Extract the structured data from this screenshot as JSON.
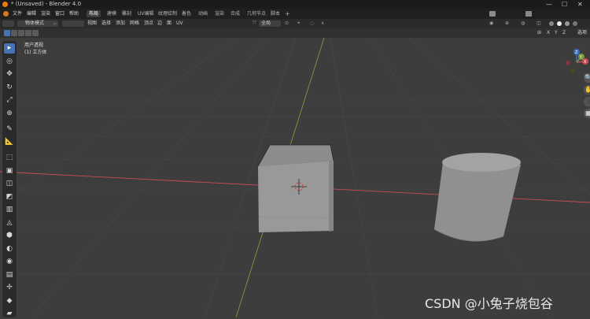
{
  "window": {
    "title": "* (Unsaved) - Blender 4.0",
    "min": "—",
    "max": "☐",
    "close": "✕"
  },
  "menus": [
    "文件",
    "编辑",
    "渲染",
    "窗口",
    "帮助"
  ],
  "workspaces": [
    {
      "label": "布局",
      "active": true
    },
    {
      "label": "建模",
      "active": false
    },
    {
      "label": "雕刻",
      "active": false
    },
    {
      "label": "UV编辑",
      "active": false
    },
    {
      "label": "纹理绘制",
      "active": false
    },
    {
      "label": "着色",
      "active": false
    },
    {
      "label": "动画",
      "active": false
    },
    {
      "label": "渲染",
      "active": false
    },
    {
      "label": "合成",
      "active": false
    },
    {
      "label": "几何节点",
      "active": false
    },
    {
      "label": "脚本",
      "active": false
    }
  ],
  "add_workspace": "+",
  "header": {
    "mode": "物体模式",
    "view_menus": [
      "视图",
      "选择",
      "添加",
      "网格",
      "顶点",
      "边",
      "面",
      "UV"
    ],
    "transform_orientation": "全局",
    "options_label": "选项",
    "axes": [
      "X",
      "Y",
      "Z"
    ]
  },
  "viewport": {
    "view_name": "用户透视",
    "object_info": "(1) 立方体"
  },
  "tools": [
    {
      "name": "select-box",
      "icon": "▸",
      "selected": true
    },
    {
      "name": "cursor",
      "icon": "◎"
    },
    {
      "name": "move",
      "icon": "✥"
    },
    {
      "name": "rotate",
      "icon": "↻"
    },
    {
      "name": "scale",
      "icon": "⤢"
    },
    {
      "name": "transform",
      "icon": "⊕"
    },
    {
      "name": "annotate",
      "icon": "✎"
    },
    {
      "name": "measure",
      "icon": "📐"
    },
    {
      "name": "add-cube",
      "icon": "⬚"
    },
    {
      "name": "extrude",
      "icon": "▣"
    },
    {
      "name": "inset",
      "icon": "◫"
    },
    {
      "name": "bevel",
      "icon": "◩"
    },
    {
      "name": "loop-cut",
      "icon": "▥"
    },
    {
      "name": "knife",
      "icon": "◬"
    },
    {
      "name": "poly-build",
      "icon": "⬢"
    },
    {
      "name": "spin",
      "icon": "◐"
    },
    {
      "name": "smooth",
      "icon": "◉"
    },
    {
      "name": "edge-slide",
      "icon": "▤"
    },
    {
      "name": "shrink",
      "icon": "✢"
    },
    {
      "name": "shear",
      "icon": "◆"
    },
    {
      "name": "rip",
      "icon": "▰"
    }
  ],
  "gizmo": {
    "x": "X",
    "y": "Y",
    "z": "Z"
  },
  "nav_buttons": [
    "🔍",
    "✋",
    "🎥",
    "▦"
  ],
  "watermark": "CSDN @小兔子烧包谷",
  "colors": {
    "x_axis": "#c94b55",
    "y_axis": "#7a9a3a",
    "z_axis": "#3d6fb6",
    "accent": "#4772b3"
  }
}
